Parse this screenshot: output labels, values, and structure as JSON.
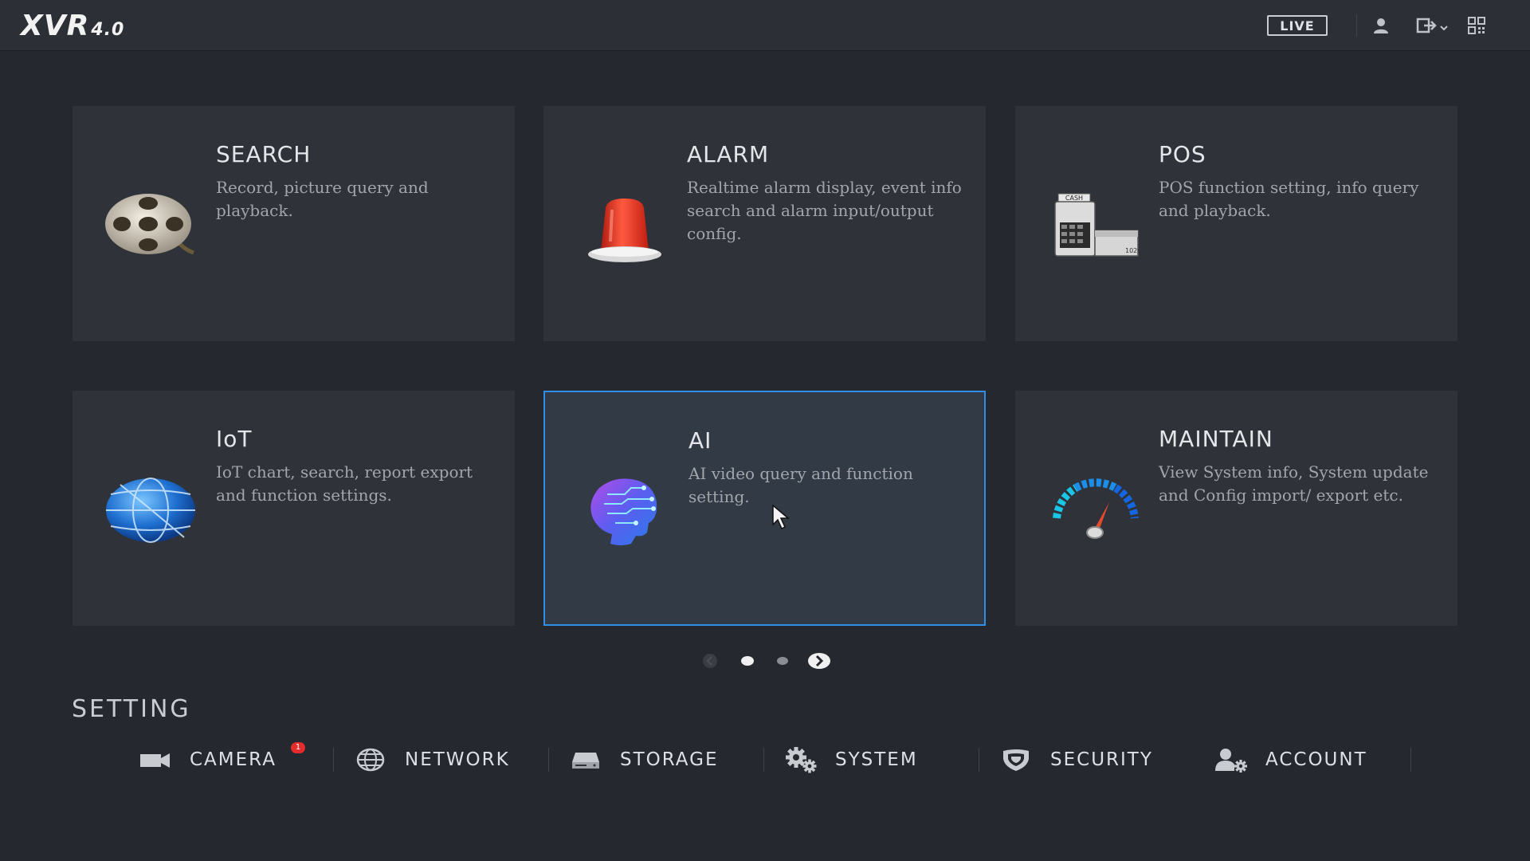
{
  "header": {
    "logo_main": "XVR",
    "logo_version": "4.0",
    "live_label": "LIVE",
    "icons": [
      "user-icon",
      "logout-icon",
      "qrcode-icon"
    ]
  },
  "cards": [
    {
      "title": "SEARCH",
      "desc": "Record, picture query and playback.",
      "icon": "film-reel-icon",
      "active": false
    },
    {
      "title": "ALARM",
      "desc": "Realtime alarm display, event info search and alarm input/output config.",
      "icon": "alarm-light-icon",
      "active": false
    },
    {
      "title": "POS",
      "desc": "POS function setting, info query and playback.",
      "icon": "cash-register-icon",
      "active": false
    },
    {
      "title": "IoT",
      "desc": "IoT chart, search, report export and function settings.",
      "icon": "globe-icon",
      "active": false
    },
    {
      "title": "AI",
      "desc": "AI video query and function setting.",
      "icon": "ai-head-icon",
      "active": true
    },
    {
      "title": "MAINTAIN",
      "desc": "View System info, System update and Config import/ export etc.",
      "icon": "gauge-icon",
      "active": false
    }
  ],
  "pager": {
    "pages": 2,
    "current": 1
  },
  "setting": {
    "title": "SETTING",
    "items": [
      {
        "label": "CAMERA",
        "icon": "camera-icon",
        "badge": "1"
      },
      {
        "label": "NETWORK",
        "icon": "network-globe-icon"
      },
      {
        "label": "STORAGE",
        "icon": "storage-drive-icon"
      },
      {
        "label": "SYSTEM",
        "icon": "gears-icon"
      },
      {
        "label": "SECURITY",
        "icon": "shield-icon"
      },
      {
        "label": "ACCOUNT",
        "icon": "account-gear-icon"
      }
    ]
  },
  "colors": {
    "background": "#25292f",
    "card": "#2f3339",
    "active_border": "#2f8ee5",
    "badge": "#e52c2c"
  }
}
